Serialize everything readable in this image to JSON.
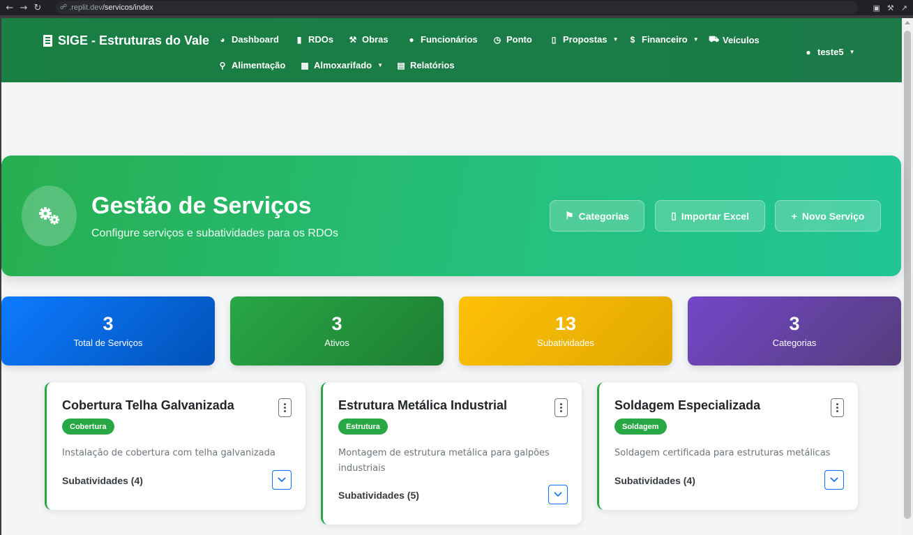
{
  "browser": {
    "url_prefix": ".replit.dev",
    "url_path": "/servicos/index"
  },
  "navbar": {
    "brand": "SIGE - Estruturas do Vale",
    "items": [
      {
        "label": "Dashboard",
        "icon": "dashboard-icon"
      },
      {
        "label": "RDOs",
        "icon": "clipboard-icon"
      },
      {
        "label": "Obras",
        "icon": "hammer-icon"
      },
      {
        "label": "Funcionários",
        "icon": "users-icon"
      },
      {
        "label": "Ponto",
        "icon": "clock-icon"
      },
      {
        "label": "Propostas",
        "icon": "file-icon",
        "dropdown": true
      },
      {
        "label": "Financeiro",
        "icon": "dollar-icon",
        "dropdown": true
      },
      {
        "label": "Veículos",
        "icon": "car-icon"
      },
      {
        "label": "Alimentação",
        "icon": "utensils-icon"
      },
      {
        "label": "Almoxarifado",
        "icon": "boxes-icon",
        "dropdown": true
      },
      {
        "label": "Relatórios",
        "icon": "chart-icon"
      }
    ],
    "user": "teste5"
  },
  "hero": {
    "title": "Gestão de Serviços",
    "subtitle": "Configure serviços e subatividades para os RDOs",
    "buttons": {
      "categorias": "Categorias",
      "importar": "Importar Excel",
      "novo": "Novo Serviço"
    }
  },
  "stats": [
    {
      "value": "3",
      "label": "Total de Serviços",
      "color": "#0d6efd"
    },
    {
      "value": "3",
      "label": "Ativos",
      "color": "#28a745"
    },
    {
      "value": "13",
      "label": "Subatividades",
      "color": "#ffc107"
    },
    {
      "value": "3",
      "label": "Categorias",
      "color": "#6f42c1"
    }
  ],
  "services": [
    {
      "title": "Cobertura Telha Galvanizada",
      "category": "Cobertura",
      "description": "Instalação de cobertura com telha galvanizada",
      "subatividades": "Subatividades (4)"
    },
    {
      "title": "Estrutura Metálica Industrial",
      "category": "Estrutura",
      "description": "Montagem de estrutura metálica para galpões industriais",
      "subatividades": "Subatividades (5)"
    },
    {
      "title": "Soldagem Especializada",
      "category": "Soldagem",
      "description": "Soldagem certificada para estruturas metálicas",
      "subatividades": "Subatividades (4)"
    }
  ],
  "colors": {
    "navbar": "#1a7f43",
    "accent": "#28a745",
    "link": "#0d6efd"
  }
}
